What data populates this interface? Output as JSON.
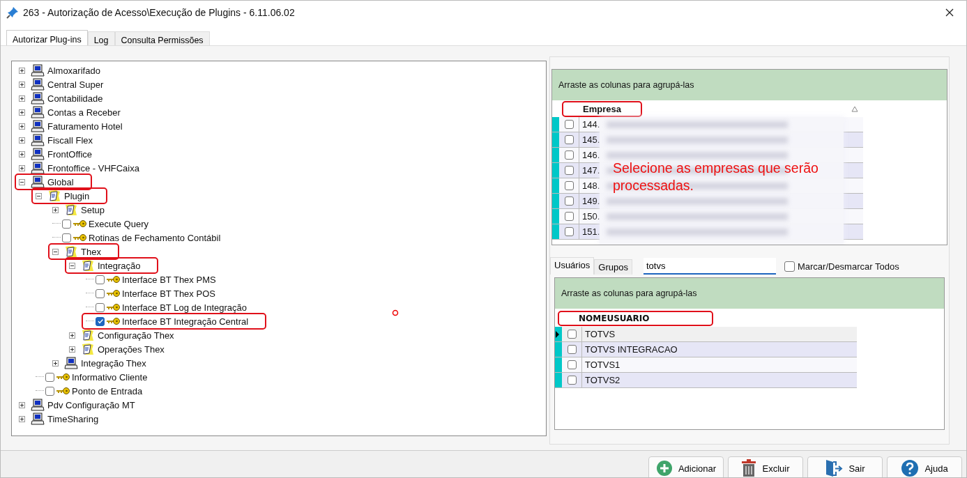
{
  "window": {
    "title": "263 - Autorização de Acesso\\Execução de Plugins - 6.11.06.02"
  },
  "tabs": [
    {
      "label": "Autorizar Plug-ins",
      "selected": true
    },
    {
      "label": "Log",
      "selected": false
    },
    {
      "label": "Consulta Permissões",
      "selected": false
    }
  ],
  "tree": [
    {
      "kind": "module",
      "label": "Almoxarifado",
      "expanded": false,
      "highlighted": false
    },
    {
      "kind": "module",
      "label": "Central Super",
      "expanded": false,
      "highlighted": false
    },
    {
      "kind": "module",
      "label": "Contabilidade",
      "expanded": false,
      "highlighted": false
    },
    {
      "kind": "module",
      "label": "Contas a Receber",
      "expanded": false,
      "highlighted": false
    },
    {
      "kind": "module",
      "label": "Faturamento Hotel",
      "expanded": false,
      "highlighted": false
    },
    {
      "kind": "module",
      "label": "Fiscall Flex",
      "expanded": false,
      "highlighted": false
    },
    {
      "kind": "module",
      "label": "FrontOffice",
      "expanded": false,
      "highlighted": false
    },
    {
      "kind": "module",
      "label": "Frontoffice - VHFCaixa",
      "expanded": false,
      "highlighted": false
    },
    {
      "kind": "module",
      "label": "Global",
      "expanded": true,
      "highlighted": true,
      "children": [
        {
          "kind": "group",
          "label": "Plugin",
          "expanded": true,
          "highlighted": true,
          "children": [
            {
              "kind": "group",
              "label": "Setup",
              "expanded": false,
              "highlighted": false
            },
            {
              "kind": "permission",
              "label": "Execute Query",
              "checked": false,
              "highlighted": false
            },
            {
              "kind": "permission",
              "label": "Rotinas de Fechamento Contábil",
              "checked": false,
              "highlighted": false
            },
            {
              "kind": "group",
              "label": "Thex",
              "expanded": true,
              "highlighted": true,
              "children": [
                {
                  "kind": "group",
                  "label": "Integração",
                  "expanded": true,
                  "highlighted": true,
                  "children": [
                    {
                      "kind": "permission",
                      "label": "Interface BT Thex PMS",
                      "checked": false,
                      "highlighted": false
                    },
                    {
                      "kind": "permission",
                      "label": "Interface BT Thex POS",
                      "checked": false,
                      "highlighted": false
                    },
                    {
                      "kind": "permission",
                      "label": "Interface BT Log de Integração",
                      "checked": false,
                      "highlighted": false
                    },
                    {
                      "kind": "permission",
                      "label": "Interface BT Integração Central",
                      "checked": true,
                      "highlighted": true
                    }
                  ]
                },
                {
                  "kind": "group",
                  "label": "Configuração Thex",
                  "expanded": false,
                  "highlighted": false
                },
                {
                  "kind": "group",
                  "label": "Operações Thex",
                  "expanded": false,
                  "highlighted": false
                }
              ]
            },
            {
              "kind": "module",
              "label": "Integração Thex",
              "expanded": false,
              "highlighted": false
            }
          ]
        },
        {
          "kind": "permission",
          "label": "Informativo Cliente",
          "checked": false,
          "highlighted": false
        },
        {
          "kind": "permission",
          "label": "Ponto de Entrada",
          "checked": false,
          "highlighted": false
        }
      ]
    },
    {
      "kind": "module",
      "label": "Pdv Configuração MT",
      "expanded": false,
      "highlighted": false
    },
    {
      "kind": "module",
      "label": "TimeSharing",
      "expanded": false,
      "highlighted": false
    }
  ],
  "companies": {
    "group_hint": "Arraste as colunas para agrupá-las",
    "column": {
      "label": "Empresa",
      "highlighted": true
    },
    "rows": [
      {
        "code": "144.",
        "checked": false
      },
      {
        "code": "145.",
        "checked": false
      },
      {
        "code": "146.",
        "checked": false
      },
      {
        "code": "147.",
        "checked": false
      },
      {
        "code": "148.",
        "checked": false
      },
      {
        "code": "149.",
        "checked": false
      },
      {
        "code": "150.",
        "checked": false
      },
      {
        "code": "151.",
        "checked": false
      }
    ]
  },
  "annotation": "Selecione as empresas que serão processadas.",
  "user_tabs": [
    {
      "label": "Usuários",
      "selected": true
    },
    {
      "label": "Grupos",
      "selected": false
    }
  ],
  "search": {
    "value": "totvs"
  },
  "toggle_all": {
    "label": "Marcar/Desmarcar Todos",
    "checked": false
  },
  "users": {
    "group_hint": "Arraste as colunas para agrupá-las",
    "column": {
      "label": "NOMEUSUARIO",
      "highlighted": true
    },
    "rows": [
      {
        "name": "TOTVS",
        "checked": false,
        "selected": true
      },
      {
        "name": "TOTVS INTEGRACAO",
        "checked": false,
        "selected": false
      },
      {
        "name": "TOTVS1",
        "checked": false,
        "selected": false
      },
      {
        "name": "TOTVS2",
        "checked": false,
        "selected": false
      }
    ]
  },
  "buttons": [
    {
      "kind": "add",
      "label": "Adicionar"
    },
    {
      "kind": "delete",
      "label": "Excluir"
    },
    {
      "kind": "exit",
      "label": "Sair"
    },
    {
      "kind": "help",
      "label": "Ajuda"
    }
  ]
}
